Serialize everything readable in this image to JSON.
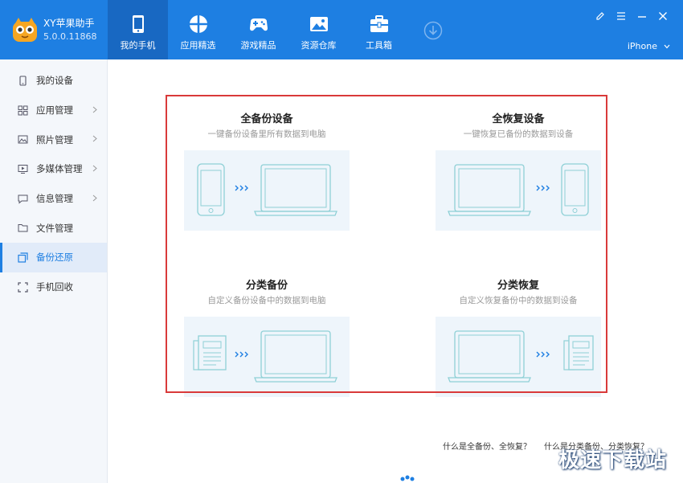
{
  "app": {
    "name": "XY苹果助手",
    "version": "5.0.0.11868",
    "accent": "#1e7fe2"
  },
  "nav": [
    {
      "label": "我的手机",
      "icon": "phone-icon",
      "active": true
    },
    {
      "label": "应用精选",
      "icon": "apps-icon"
    },
    {
      "label": "游戏精品",
      "icon": "gamepad-icon"
    },
    {
      "label": "资源仓库",
      "icon": "image-icon"
    },
    {
      "label": "工具箱",
      "icon": "toolbox-icon"
    }
  ],
  "device": {
    "selected": "iPhone"
  },
  "sidebar": [
    {
      "label": "我的设备",
      "icon": "device-icon"
    },
    {
      "label": "应用管理",
      "icon": "grid-icon",
      "arrow": true
    },
    {
      "label": "照片管理",
      "icon": "photo-icon",
      "arrow": true
    },
    {
      "label": "多媒体管理",
      "icon": "media-icon",
      "arrow": true
    },
    {
      "label": "信息管理",
      "icon": "message-icon",
      "arrow": true
    },
    {
      "label": "文件管理",
      "icon": "folder-icon"
    },
    {
      "label": "备份还原",
      "icon": "backup-icon",
      "active": true
    },
    {
      "label": "手机回收",
      "icon": "recycle-icon"
    }
  ],
  "cards": [
    {
      "title": "全备份设备",
      "subtitle": "一键备份设备里所有数据到电脑"
    },
    {
      "title": "全恢复设备",
      "subtitle": "一键恢复已备份的数据到设备"
    },
    {
      "title": "分类备份",
      "subtitle": "自定义备份设备中的数据到电脑"
    },
    {
      "title": "分类恢复",
      "subtitle": "自定义恢复备份中的数据到设备"
    }
  ],
  "help": {
    "full_link": "什么是全备份、全恢复？",
    "category_link": "什么是分类备份、分类恢复？"
  },
  "watermark": "极速下载站"
}
